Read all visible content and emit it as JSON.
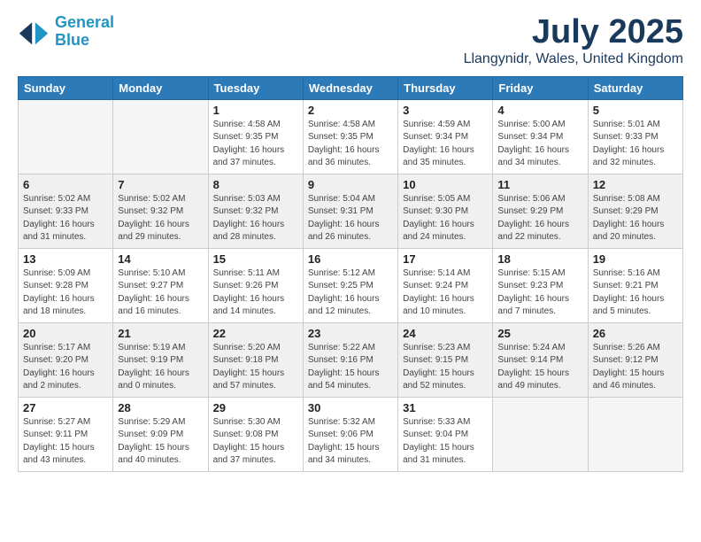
{
  "header": {
    "logo_line1": "General",
    "logo_line2": "Blue",
    "month": "July 2025",
    "location": "Llangynidr, Wales, United Kingdom"
  },
  "days_of_week": [
    "Sunday",
    "Monday",
    "Tuesday",
    "Wednesday",
    "Thursday",
    "Friday",
    "Saturday"
  ],
  "weeks": [
    [
      {
        "day": "",
        "detail": ""
      },
      {
        "day": "",
        "detail": ""
      },
      {
        "day": "1",
        "detail": "Sunrise: 4:58 AM\nSunset: 9:35 PM\nDaylight: 16 hours\nand 37 minutes."
      },
      {
        "day": "2",
        "detail": "Sunrise: 4:58 AM\nSunset: 9:35 PM\nDaylight: 16 hours\nand 36 minutes."
      },
      {
        "day": "3",
        "detail": "Sunrise: 4:59 AM\nSunset: 9:34 PM\nDaylight: 16 hours\nand 35 minutes."
      },
      {
        "day": "4",
        "detail": "Sunrise: 5:00 AM\nSunset: 9:34 PM\nDaylight: 16 hours\nand 34 minutes."
      },
      {
        "day": "5",
        "detail": "Sunrise: 5:01 AM\nSunset: 9:33 PM\nDaylight: 16 hours\nand 32 minutes."
      }
    ],
    [
      {
        "day": "6",
        "detail": "Sunrise: 5:02 AM\nSunset: 9:33 PM\nDaylight: 16 hours\nand 31 minutes."
      },
      {
        "day": "7",
        "detail": "Sunrise: 5:02 AM\nSunset: 9:32 PM\nDaylight: 16 hours\nand 29 minutes."
      },
      {
        "day": "8",
        "detail": "Sunrise: 5:03 AM\nSunset: 9:32 PM\nDaylight: 16 hours\nand 28 minutes."
      },
      {
        "day": "9",
        "detail": "Sunrise: 5:04 AM\nSunset: 9:31 PM\nDaylight: 16 hours\nand 26 minutes."
      },
      {
        "day": "10",
        "detail": "Sunrise: 5:05 AM\nSunset: 9:30 PM\nDaylight: 16 hours\nand 24 minutes."
      },
      {
        "day": "11",
        "detail": "Sunrise: 5:06 AM\nSunset: 9:29 PM\nDaylight: 16 hours\nand 22 minutes."
      },
      {
        "day": "12",
        "detail": "Sunrise: 5:08 AM\nSunset: 9:29 PM\nDaylight: 16 hours\nand 20 minutes."
      }
    ],
    [
      {
        "day": "13",
        "detail": "Sunrise: 5:09 AM\nSunset: 9:28 PM\nDaylight: 16 hours\nand 18 minutes."
      },
      {
        "day": "14",
        "detail": "Sunrise: 5:10 AM\nSunset: 9:27 PM\nDaylight: 16 hours\nand 16 minutes."
      },
      {
        "day": "15",
        "detail": "Sunrise: 5:11 AM\nSunset: 9:26 PM\nDaylight: 16 hours\nand 14 minutes."
      },
      {
        "day": "16",
        "detail": "Sunrise: 5:12 AM\nSunset: 9:25 PM\nDaylight: 16 hours\nand 12 minutes."
      },
      {
        "day": "17",
        "detail": "Sunrise: 5:14 AM\nSunset: 9:24 PM\nDaylight: 16 hours\nand 10 minutes."
      },
      {
        "day": "18",
        "detail": "Sunrise: 5:15 AM\nSunset: 9:23 PM\nDaylight: 16 hours\nand 7 minutes."
      },
      {
        "day": "19",
        "detail": "Sunrise: 5:16 AM\nSunset: 9:21 PM\nDaylight: 16 hours\nand 5 minutes."
      }
    ],
    [
      {
        "day": "20",
        "detail": "Sunrise: 5:17 AM\nSunset: 9:20 PM\nDaylight: 16 hours\nand 2 minutes."
      },
      {
        "day": "21",
        "detail": "Sunrise: 5:19 AM\nSunset: 9:19 PM\nDaylight: 16 hours\nand 0 minutes."
      },
      {
        "day": "22",
        "detail": "Sunrise: 5:20 AM\nSunset: 9:18 PM\nDaylight: 15 hours\nand 57 minutes."
      },
      {
        "day": "23",
        "detail": "Sunrise: 5:22 AM\nSunset: 9:16 PM\nDaylight: 15 hours\nand 54 minutes."
      },
      {
        "day": "24",
        "detail": "Sunrise: 5:23 AM\nSunset: 9:15 PM\nDaylight: 15 hours\nand 52 minutes."
      },
      {
        "day": "25",
        "detail": "Sunrise: 5:24 AM\nSunset: 9:14 PM\nDaylight: 15 hours\nand 49 minutes."
      },
      {
        "day": "26",
        "detail": "Sunrise: 5:26 AM\nSunset: 9:12 PM\nDaylight: 15 hours\nand 46 minutes."
      }
    ],
    [
      {
        "day": "27",
        "detail": "Sunrise: 5:27 AM\nSunset: 9:11 PM\nDaylight: 15 hours\nand 43 minutes."
      },
      {
        "day": "28",
        "detail": "Sunrise: 5:29 AM\nSunset: 9:09 PM\nDaylight: 15 hours\nand 40 minutes."
      },
      {
        "day": "29",
        "detail": "Sunrise: 5:30 AM\nSunset: 9:08 PM\nDaylight: 15 hours\nand 37 minutes."
      },
      {
        "day": "30",
        "detail": "Sunrise: 5:32 AM\nSunset: 9:06 PM\nDaylight: 15 hours\nand 34 minutes."
      },
      {
        "day": "31",
        "detail": "Sunrise: 5:33 AM\nSunset: 9:04 PM\nDaylight: 15 hours\nand 31 minutes."
      },
      {
        "day": "",
        "detail": ""
      },
      {
        "day": "",
        "detail": ""
      }
    ]
  ]
}
